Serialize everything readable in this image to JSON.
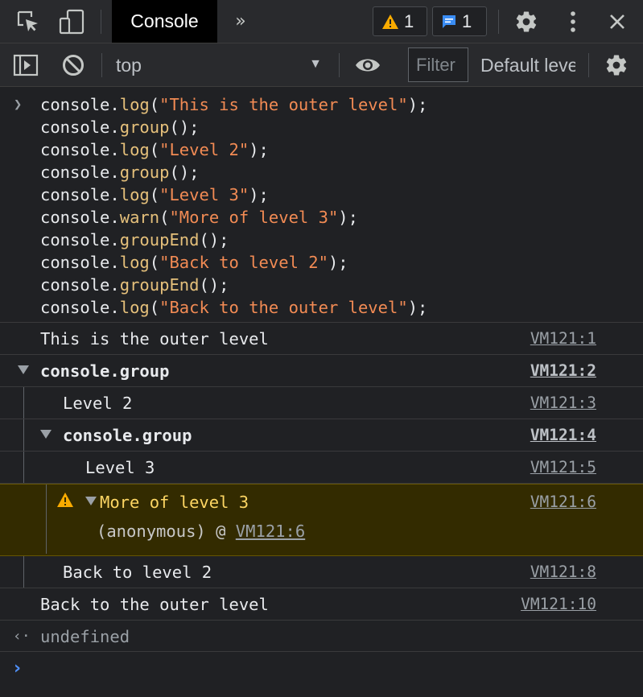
{
  "tabbar": {
    "active_tab": "Console",
    "warning_count": "1",
    "message_count": "1",
    "icons": [
      "inspect-element-icon",
      "device-toolbar-icon",
      "more-tabs-icon",
      "warning-icon",
      "message-icon",
      "settings-icon",
      "more-options-icon",
      "close-icon"
    ]
  },
  "toolbar": {
    "context": "top",
    "filter_placeholder": "Filter",
    "levels_label": "Default levels",
    "icons": [
      "sidebar-toggle-icon",
      "clear-console-icon",
      "live-expression-eye-icon",
      "console-settings-icon"
    ]
  },
  "input_code": [
    {
      "obj": "console.",
      "fn": "log",
      "open": "(",
      "str": "\"This is the outer level\"",
      "close": ");"
    },
    {
      "obj": "console.",
      "fn": "group",
      "open": "(",
      "str": "",
      "close": ");"
    },
    {
      "obj": "console.",
      "fn": "log",
      "open": "(",
      "str": "\"Level 2\"",
      "close": ");"
    },
    {
      "obj": "console.",
      "fn": "group",
      "open": "(",
      "str": "",
      "close": ");"
    },
    {
      "obj": "console.",
      "fn": "log",
      "open": "(",
      "str": "\"Level 3\"",
      "close": ");"
    },
    {
      "obj": "console.",
      "fn": "warn",
      "open": "(",
      "str": "\"More of level 3\"",
      "close": ");"
    },
    {
      "obj": "console.",
      "fn": "groupEnd",
      "open": "(",
      "str": "",
      "close": ");"
    },
    {
      "obj": "console.",
      "fn": "log",
      "open": "(",
      "str": "\"Back to level 2\"",
      "close": ");"
    },
    {
      "obj": "console.",
      "fn": "groupEnd",
      "open": "(",
      "str": "",
      "close": ");"
    },
    {
      "obj": "console.",
      "fn": "log",
      "open": "(",
      "str": "\"Back to the outer level\"",
      "close": ");"
    }
  ],
  "output": {
    "outer": {
      "text": "This is the outer level",
      "source": "VM121:1"
    },
    "group1": {
      "text": "console.group",
      "source": "VM121:2"
    },
    "level2": {
      "text": "Level 2",
      "source": "VM121:3"
    },
    "group2": {
      "text": "console.group",
      "source": "VM121:4"
    },
    "level3": {
      "text": "Level 3",
      "source": "VM121:5"
    },
    "warning": {
      "text": "More of level 3",
      "source": "VM121:6",
      "trace_fn": "(anonymous)",
      "trace_at": " @ ",
      "trace_link": "VM121:6"
    },
    "back2": {
      "text": "Back to level 2",
      "source": "VM121:8"
    },
    "back_outer": {
      "text": "Back to the outer level",
      "source": "VM121:10"
    },
    "result": "undefined"
  },
  "colors": {
    "background": "#202124",
    "toolbar": "#292a2d",
    "string": "#f28b54",
    "function": "#e5c07b",
    "warning_bg": "#332b00",
    "warning_text": "#fdd663",
    "prompt": "#4f8ff7"
  }
}
